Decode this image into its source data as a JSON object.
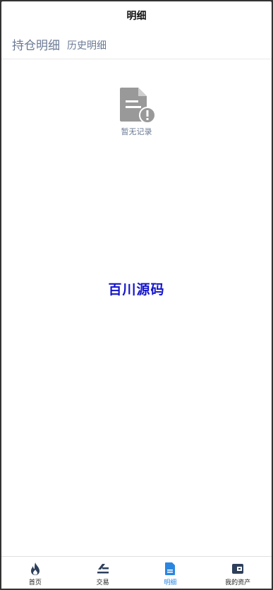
{
  "header": {
    "title": "明细"
  },
  "tabs": [
    {
      "label": "持仓明细",
      "active": true
    },
    {
      "label": "历史明细",
      "active": false
    }
  ],
  "empty_state": {
    "icon": "document-warning-icon",
    "label": "暂无记录"
  },
  "watermark": {
    "text": "百川源码"
  },
  "tabbar": {
    "items": [
      {
        "label": "首页",
        "icon": "flame-icon",
        "active": false
      },
      {
        "label": "交易",
        "icon": "trade-icon",
        "active": false
      },
      {
        "label": "明细",
        "icon": "document-icon",
        "active": true
      },
      {
        "label": "我的资产",
        "icon": "wallet-icon",
        "active": false
      }
    ]
  },
  "colors": {
    "accent": "#2b86e0",
    "tab_text": "#6b7a95",
    "icon_dark": "#2d3f5a",
    "empty_icon": "#999999",
    "watermark": "#1414cc"
  }
}
